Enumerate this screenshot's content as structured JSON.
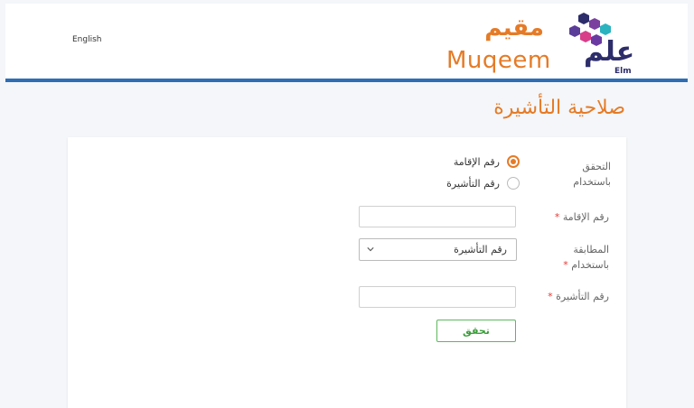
{
  "header": {
    "language_link": "English",
    "muqeem_logo": {
      "arabic": "مقيم",
      "english": "Muqeem"
    },
    "elm_logo": {
      "arabic": "علم",
      "english": "Elm"
    }
  },
  "page": {
    "title": "صلاحية التأشيرة"
  },
  "form": {
    "verify_by_label": "التحقق باستخدام",
    "verify_by_options": [
      {
        "label": "رقم الإقامة",
        "selected": true
      },
      {
        "label": "رقم التأشيرة",
        "selected": false
      }
    ],
    "iqama_number_label": "رقم الإقامة",
    "iqama_number_value": "",
    "match_by_label": "المطابقة باستخدام",
    "match_by_selected": "رقم التأشيرة",
    "visa_number_label": "رقم التأشيرة",
    "visa_number_value": "",
    "required_mark": "*",
    "submit_label": "تحقق"
  },
  "colors": {
    "accent": "#e57b27",
    "header_rule": "#2f6db4",
    "button": "#5cb85c",
    "required": "#e53935",
    "elm_brand": "#2d2d6b"
  }
}
